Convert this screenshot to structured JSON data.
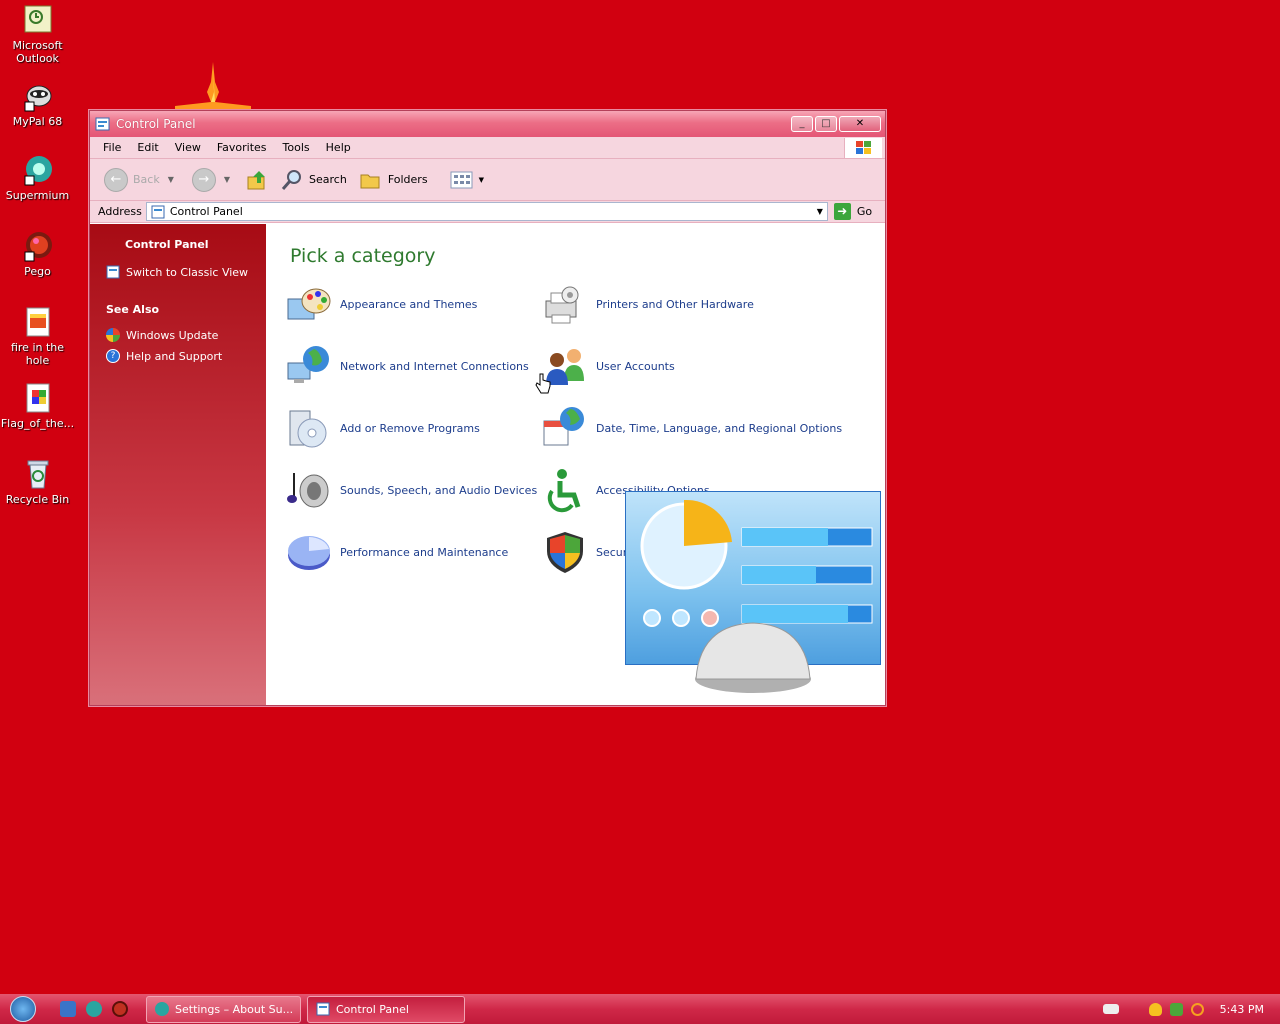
{
  "desktop": {
    "icons": [
      {
        "label": "Microsoft Outlook",
        "icon": "outlook-icon"
      },
      {
        "label": "MyPal 68",
        "icon": "mypal-icon"
      },
      {
        "label": "Supermium",
        "icon": "supermium-icon"
      },
      {
        "label": "Pego",
        "icon": "pego-icon"
      },
      {
        "label": "fire in the hole",
        "icon": "image-file-icon"
      },
      {
        "label": "Flag_of_the...",
        "icon": "image-file-icon"
      },
      {
        "label": "Recycle Bin",
        "icon": "recycle-bin-icon"
      }
    ]
  },
  "window": {
    "title": "Control Panel",
    "menu": [
      "File",
      "Edit",
      "View",
      "Favorites",
      "Tools",
      "Help"
    ],
    "toolbar": {
      "back": "Back",
      "search": "Search",
      "folders": "Folders"
    },
    "address": {
      "label": "Address",
      "value": "Control Panel",
      "go": "Go"
    }
  },
  "sidebar": {
    "panel_title": "Control Panel",
    "switch_view": "Switch to Classic View",
    "see_also_title": "See Also",
    "see_also": [
      "Windows Update",
      "Help and Support"
    ]
  },
  "main": {
    "heading": "Pick a category",
    "categories": [
      {
        "label": "Appearance and Themes",
        "icon": "appearance-icon"
      },
      {
        "label": "Printers and Other Hardware",
        "icon": "printer-icon"
      },
      {
        "label": "Network and Internet Connections",
        "icon": "network-icon"
      },
      {
        "label": "User Accounts",
        "icon": "user-accounts-icon"
      },
      {
        "label": "Add or Remove Programs",
        "icon": "programs-icon"
      },
      {
        "label": "Date, Time, Language, and Regional Options",
        "icon": "date-time-icon"
      },
      {
        "label": "Sounds, Speech, and Audio Devices",
        "icon": "sounds-icon"
      },
      {
        "label": "Accessibility Options",
        "icon": "accessibility-icon"
      },
      {
        "label": "Performance and Maintenance",
        "icon": "performance-icon"
      },
      {
        "label": "Security Center",
        "icon": "security-shield-icon"
      }
    ]
  },
  "taskbar": {
    "tasks": [
      {
        "label": "Settings – About Su...",
        "active": false
      },
      {
        "label": "Control Panel",
        "active": true
      }
    ],
    "clock": "5:43 PM"
  },
  "colors": {
    "desktop": "#d10010",
    "heading": "#2f7a2f",
    "link": "#1d3d8c"
  }
}
